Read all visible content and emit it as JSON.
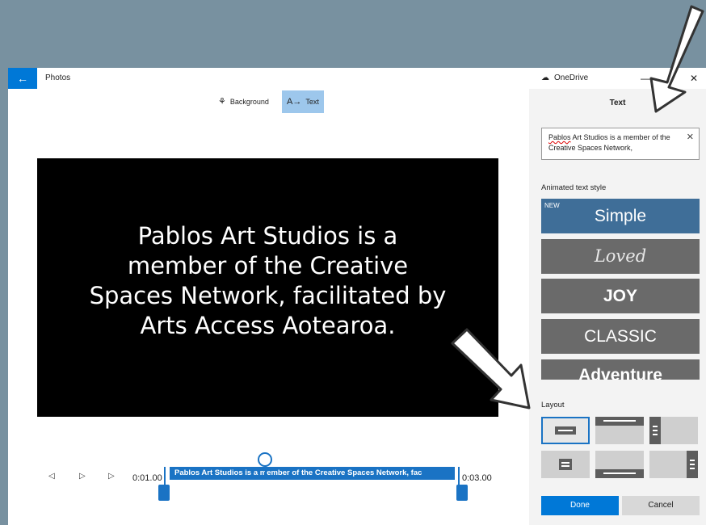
{
  "titlebar": {
    "back_icon": "←",
    "app_title": "Photos",
    "onedrive_icon": "☁",
    "onedrive_label": "OneDrive",
    "minimize": "—",
    "close": "✕"
  },
  "toolbar": {
    "background_label": "Background",
    "background_icon": "⚘",
    "text_label": "Text",
    "text_icon": "A→"
  },
  "preview": {
    "text": "Pablos Art Studios is a member of the Creative Spaces Network, facilitated by Arts Access Aotearoa."
  },
  "timeline": {
    "prev_icon": "◁",
    "play_icon": "▷",
    "next_icon": "▷",
    "start_time": "0:01.00",
    "end_time": "0:03.00",
    "clip_text": "Pablos Art Studios is a member of the Creative Spaces Network, fac"
  },
  "panel": {
    "title": "Text",
    "text_value_first": "Pablos",
    "text_value_rest": " Art Studios is a member of the Creative Spaces Network,",
    "clear_icon": "✕",
    "styles_label": "Animated text style",
    "styles": [
      {
        "label": "Simple",
        "badge": "NEW",
        "selected": true
      },
      {
        "label": "Loved"
      },
      {
        "label": "JOY"
      },
      {
        "label": "CLASSIC"
      },
      {
        "label": "Adventure"
      }
    ],
    "layout_label": "Layout",
    "done_label": "Done",
    "cancel_label": "Cancel"
  },
  "colors": {
    "accent": "#0078d7",
    "selected_style": "#3f6e98",
    "style_tile": "#6a6a6a",
    "desktop": "#7891a0"
  }
}
